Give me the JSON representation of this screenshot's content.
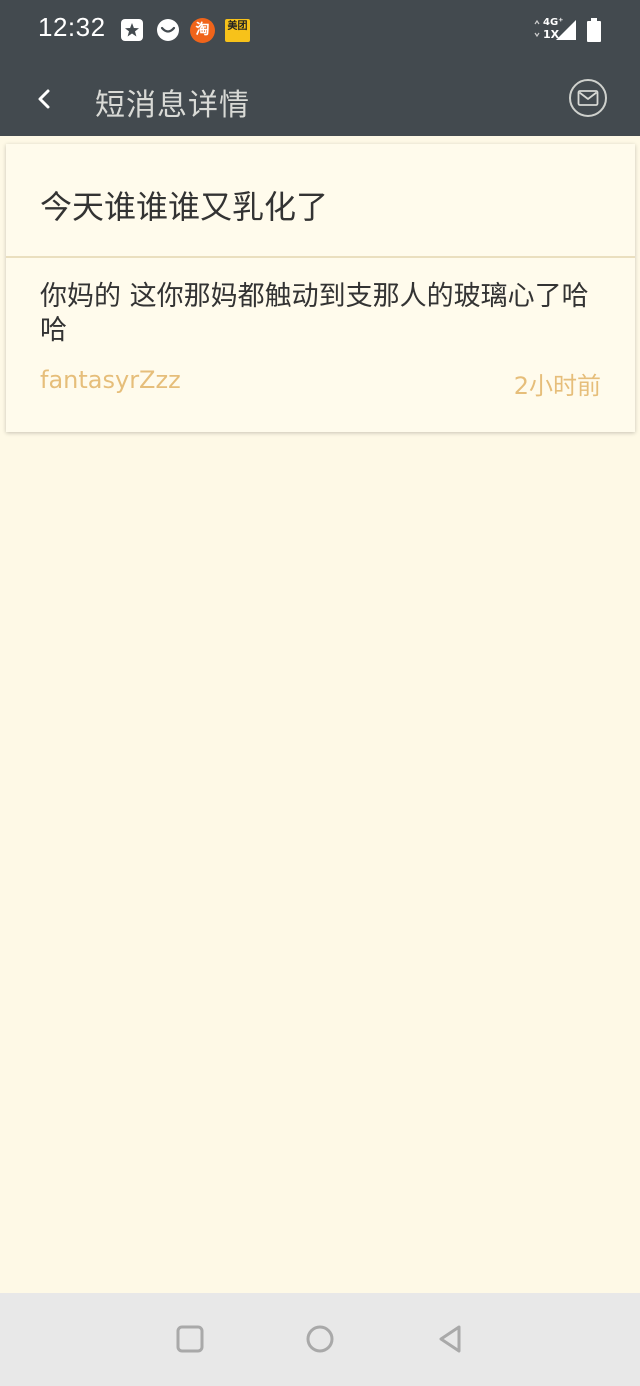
{
  "status_bar": {
    "time": "12:32",
    "icons": [
      "star-badge-icon",
      "moon-icon",
      "taobao-app-icon",
      "meituan-app-icon",
      "network-4g-icon",
      "battery-icon"
    ],
    "taobao_label": "淘",
    "meituan_label": "美团",
    "network_label_top": "4G⁺",
    "network_label_bottom": "1X"
  },
  "app_bar": {
    "title": "短消息详情",
    "back_icon": "chevron-left-icon",
    "mail_icon": "envelope-icon",
    "background": "#434a4f"
  },
  "message": {
    "title": "今天谁谁谁又乳化了",
    "body": "你妈的 这你那妈都触动到支那人的玻璃心了哈哈",
    "author": "fantasyrZzz",
    "time": "2小时前",
    "accent_color": "#e6be7a"
  },
  "nav_bar": {
    "buttons": [
      "recents-square-icon",
      "home-circle-icon",
      "back-triangle-icon"
    ]
  }
}
